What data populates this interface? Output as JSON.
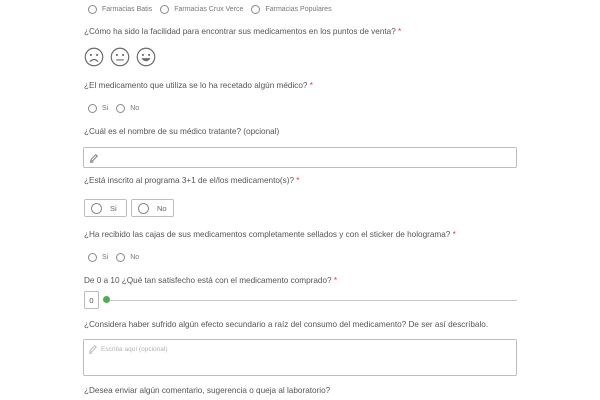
{
  "pharmacies": {
    "options": [
      "Farmacias Batis",
      "Farmacias Crux Verce",
      "Farmacias Populares"
    ]
  },
  "q_ease": {
    "label": "¿Cómo ha sido la facilidad para encontrar sus medicamentos en los puntos de venta?",
    "required_mark": "*",
    "faces": [
      "sad-face-icon",
      "neutral-face-icon",
      "happy-face-icon"
    ]
  },
  "q_prescribed": {
    "label": "¿El medicamento que utiliza se lo ha recetado algún médico?",
    "required_mark": "*",
    "options": [
      "Si",
      "No"
    ]
  },
  "q_doctor": {
    "label": "¿Cuál es el nombre de su médico tratante? (opcional)",
    "icon": "pencil-icon",
    "value": ""
  },
  "q_program": {
    "label": "¿Está inscrito al programa 3+1 de el/los medicamento(s)?",
    "required_mark": "*",
    "options": [
      "Si",
      "No"
    ]
  },
  "q_sealed": {
    "label": "¿Ha recibido las cajas de sus medicamentos completamente sellados y con el sticker de holograma?",
    "required_mark": "*",
    "options": [
      "Si",
      "No"
    ]
  },
  "q_satisfaction": {
    "label": "De 0 a 10 ¿Qué tan satisfecho está con el medicamento comprado?",
    "required_mark": "*",
    "value": "0",
    "min": 0,
    "max": 10,
    "accent_color": "#4caf50"
  },
  "q_side_effect": {
    "label": "¿Considera haber sufrido algún efecto secundario a raíz del consumo del medicamento? De ser así descríbalo.",
    "placeholder": "Escriba aquí (opcional)",
    "icon": "pencil-icon"
  },
  "q_comment": {
    "label": "¿Desea enviar algún comentario, sugerencia o queja al laboratorio?"
  }
}
